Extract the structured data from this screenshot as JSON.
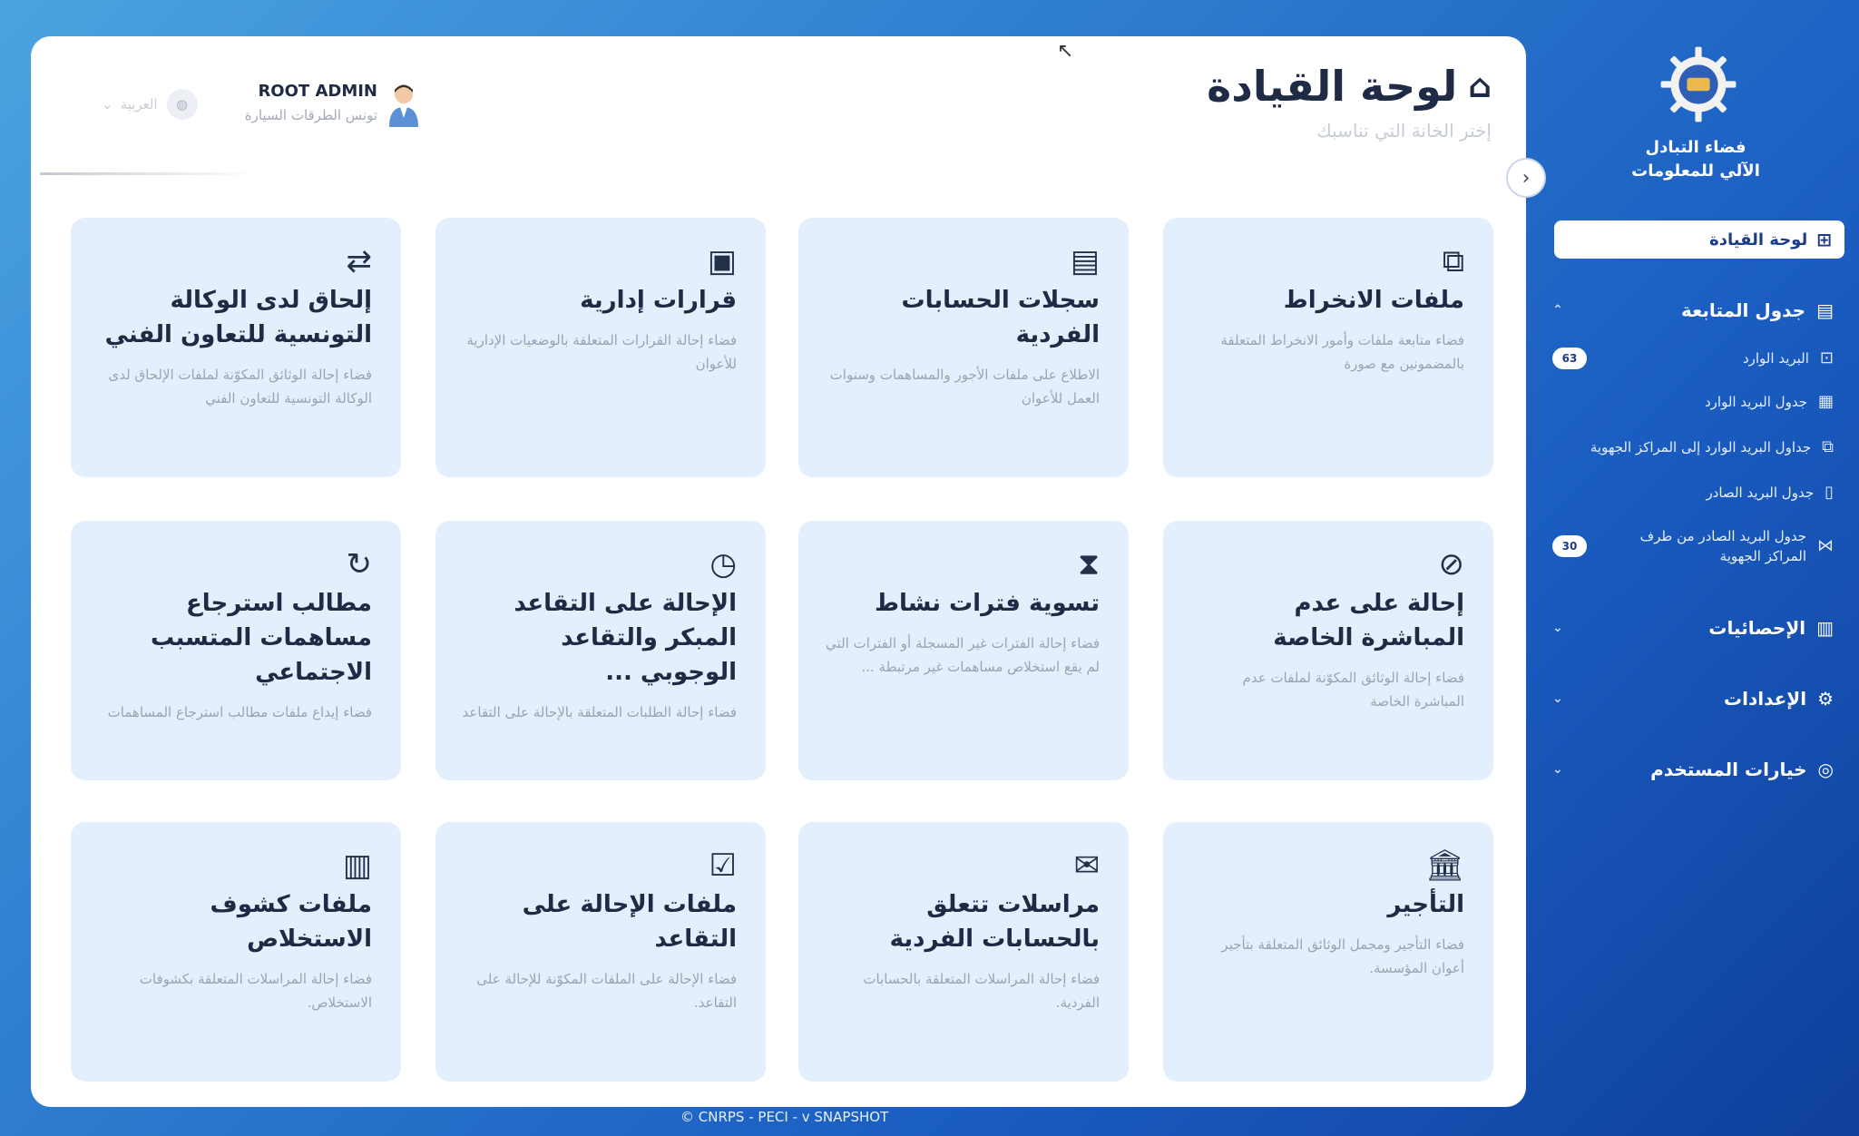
{
  "brand": {
    "line1": "فضاء التبادل",
    "line2": "الآلي للمعلومات"
  },
  "sidebar": {
    "active": "لوحة القيادة",
    "sections": {
      "followup": "جدول المتابعة",
      "stats": "الإحصائيات",
      "settings": "الإعدادات",
      "user": "خيارات المستخدم"
    },
    "subitems": [
      {
        "label": "البريد الوارد",
        "badge": "63"
      },
      {
        "label": "جدول البريد الوارد",
        "badge": ""
      },
      {
        "label": "جداول البريد الوارد إلى المراكز الجهوية",
        "badge": ""
      },
      {
        "label": "جدول البريد الصادر",
        "badge": ""
      },
      {
        "label": "جدول البريد الصادر من طرف المراكز الجهوية",
        "badge": "30"
      }
    ]
  },
  "header": {
    "title": "لوحة القيادة",
    "subtitle": "إختر الخانة التي تناسبك",
    "user_name": "ROOT ADMIN",
    "user_org": "تونس الطرقات السيارة",
    "language": "العربية"
  },
  "cards": [
    {
      "icon": "copy-icon",
      "glyph": "⧉",
      "title": "ملفات الانخراط",
      "desc": "فضاء متابعة ملفات وأمور الانخراط المتعلقة بالمضمونين مع صورة"
    },
    {
      "icon": "id-card-icon",
      "glyph": "▤",
      "title": "سجلات الحسابات الفردية",
      "desc": "الاطلاع على ملفات الأجور والمساهمات وسنوات العمل للأعوان"
    },
    {
      "icon": "archive-icon",
      "glyph": "▣",
      "title": "قرارات إدارية",
      "desc": "فضاء إحالة القرارات المتعلقة بالوضعيات الإدارية للأعوان"
    },
    {
      "icon": "transfer-icon",
      "glyph": "⇄",
      "title": "إلحاق لدى الوكالة التونسية للتعاون الفني",
      "desc": "فضاء إحالة الوثائق المكوّنة لملفات الإلحاق لدى الوكالة التونسية للتعاون الفني"
    },
    {
      "icon": "ban-icon",
      "glyph": "⊘",
      "title": "إحالة على عدم المباشرة الخاصة",
      "desc": "فضاء إحالة الوثائق المكوّنة لملفات عدم المباشرة الخاصة"
    },
    {
      "icon": "hourglass-icon",
      "glyph": "⧗",
      "title": "تسوية فترات نشاط",
      "desc": "فضاء إحالة الفترات غير المسجلة أو الفترات التي لم يقع استخلاص مساهمات غير مرتبطة ..."
    },
    {
      "icon": "folder-clock-icon",
      "glyph": "◷",
      "title": "الإحالة على التقاعد المبكر والتقاعد الوجوبي ...",
      "desc": "فضاء إحالة الطلبات المتعلقة بالإحالة على التقاعد"
    },
    {
      "icon": "refresh-icon",
      "glyph": "↻",
      "title": "مطالب استرجاع مساهمات المتسبب الاجتماعي",
      "desc": "فضاء إيداع ملفات مطالب استرجاع المساهمات"
    },
    {
      "icon": "bank-icon",
      "glyph": "🏛",
      "title": "التأجير",
      "desc": "فضاء التأجير ومجمل الوثائق المتعلقة بتأجير أعوان المؤسسة."
    },
    {
      "icon": "mail-icon",
      "glyph": "✉",
      "title": "مراسلات تتعلق بالحسابات الفردية",
      "desc": "فضاء إحالة المراسلات المتعلقة بالحسابات الفردية."
    },
    {
      "icon": "folder-check-icon",
      "glyph": "☑",
      "title": "ملفات الإحالة على التقاعد",
      "desc": "فضاء الإحالة على الملفات المكوّنة للإحالة على التقاعد."
    },
    {
      "icon": "document-icon",
      "glyph": "▥",
      "title": "ملفات كشوف الاستخلاص",
      "desc": "فضاء إحالة المراسلات المتعلقة بكشوفات الاستخلاص."
    }
  ],
  "footer": "© CNRPS - PECI - v SNAPSHOT"
}
